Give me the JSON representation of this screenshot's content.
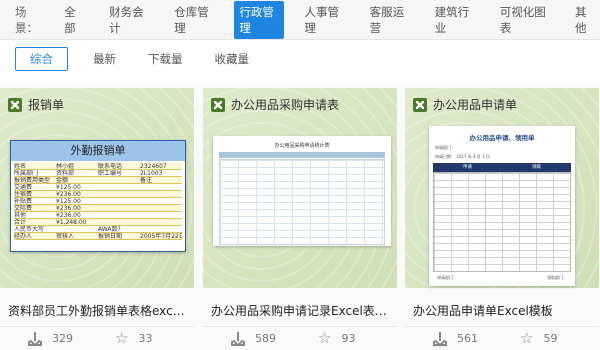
{
  "scene": {
    "label": "场景：",
    "items": [
      "全部",
      "财务会计",
      "仓库管理",
      "行政管理",
      "人事管理",
      "客服运营",
      "建筑行业",
      "可视化图表",
      "其他"
    ],
    "active_index": 3
  },
  "sort": {
    "tabs": [
      "综合",
      "最新",
      "下载量",
      "收藏量"
    ],
    "active_index": 0
  },
  "colors": {
    "accent": "#1e86e0",
    "thumb_bg": "#d9e6c4",
    "excel_icon": "#4c7a2b"
  },
  "cards": [
    {
      "category": "报销单",
      "title": "资料部员工外勤报销单表格excel...",
      "downloads": "329",
      "favorites": "33",
      "preview": {
        "heading": "外勤报销单",
        "rows": [
          [
            "姓名",
            "林小姐",
            "联系电话",
            "2324607"
          ],
          [
            "所属部门",
            "资料部",
            "职工编号",
            "2L1003"
          ],
          [
            "报销费用类型",
            "金额",
            "",
            "备注"
          ],
          [
            "交通费",
            "¥125.00",
            "",
            ""
          ],
          [
            "住宿费",
            "¥236.00",
            "",
            ""
          ],
          [
            "补贴费",
            "¥125.00",
            "",
            ""
          ],
          [
            "交际费",
            "¥236.00",
            "",
            ""
          ],
          [
            "其他",
            "¥236.00",
            "",
            ""
          ],
          [
            "合计",
            "¥1,248.00",
            "",
            ""
          ],
          [
            "人民币大写",
            "",
            "AWA数?",
            ""
          ],
          [
            "经办人",
            "审核人",
            "报销日期",
            "2005年7月22日"
          ]
        ]
      }
    },
    {
      "category": "办公用品采购申请表",
      "title": "办公用品采购申请记录Excel表格...",
      "downloads": "589",
      "favorites": "93",
      "preview": {
        "heading": "办公用品采购申请统计表"
      }
    },
    {
      "category": "办公用品申请单",
      "title": "办公用品申请单Excel模板",
      "downloads": "561",
      "favorites": "59",
      "preview": {
        "heading": "办公用品申请、领用单",
        "meta_dept": "申请部门：",
        "meta_date": "申请日期：  2017 年 4 月 1 日",
        "columns": [
          "申请",
          "领取"
        ],
        "foot_left": "申请部门：",
        "foot_right": "领取部门："
      }
    }
  ]
}
